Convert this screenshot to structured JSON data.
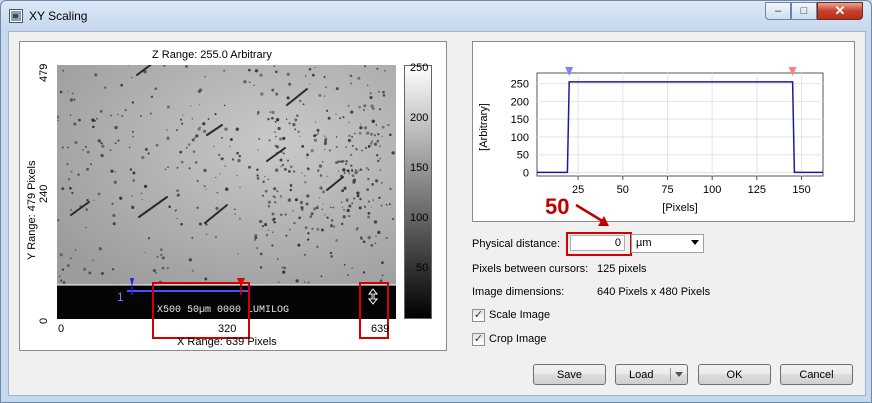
{
  "window": {
    "title": "XY Scaling",
    "controls": {
      "minimize": "–",
      "maximize": "□",
      "close": "✕"
    }
  },
  "image_panel": {
    "z_range": "Z Range:  255.0 Arbitrary",
    "x_range": "X Range: 639 Pixels",
    "y_range": "Y Range: 479 Pixels",
    "x_ticks": [
      "0",
      "320",
      "639"
    ],
    "y_ticks": [
      "479",
      "240",
      "0"
    ],
    "colorbar_ticks": [
      "250",
      "200",
      "150",
      "100",
      "50",
      "0"
    ],
    "scalebar_text": "X500    50µm   0000 LUMILOG",
    "cursor1_label": "1"
  },
  "profile_chart": {
    "y_label": "[Arbitrary]",
    "x_label": "[Pixels]",
    "y_ticks": [
      "250",
      "200",
      "150",
      "100",
      "50",
      "0"
    ],
    "x_ticks": [
      "25",
      "50",
      "75",
      "100",
      "125",
      "150"
    ]
  },
  "chart_data": {
    "type": "line",
    "xlabel": "[Pixels]",
    "ylabel": "[Arbitrary]",
    "xlim": [
      2,
      162
    ],
    "ylim": [
      -10,
      280
    ],
    "grid": true,
    "cursors": [
      {
        "color": "#7a84ff",
        "x": 20
      },
      {
        "color": "#ff8080",
        "x": 145
      }
    ],
    "x": [
      2,
      19,
      20,
      21,
      144,
      145,
      146,
      162
    ],
    "y": [
      0,
      0,
      255,
      255,
      255,
      255,
      0,
      0
    ]
  },
  "annotation": {
    "text": "50",
    "color": "#c00000"
  },
  "form": {
    "physical_distance_label": "Physical distance:",
    "physical_distance_value": "0",
    "unit_selected": "µm",
    "pixels_between_label": "Pixels between cursors:",
    "pixels_between_value": "125 pixels",
    "image_dimensions_label": "Image dimensions:",
    "image_dimensions_value": "640 Pixels x 480 Pixels",
    "scale_image_label": "Scale Image",
    "scale_image_checked": true,
    "crop_image_label": "Crop Image",
    "crop_image_checked": true
  },
  "buttons": {
    "save": "Save",
    "load": "Load",
    "ok": "OK",
    "cancel": "Cancel"
  },
  "highlight_color": "#d40000"
}
